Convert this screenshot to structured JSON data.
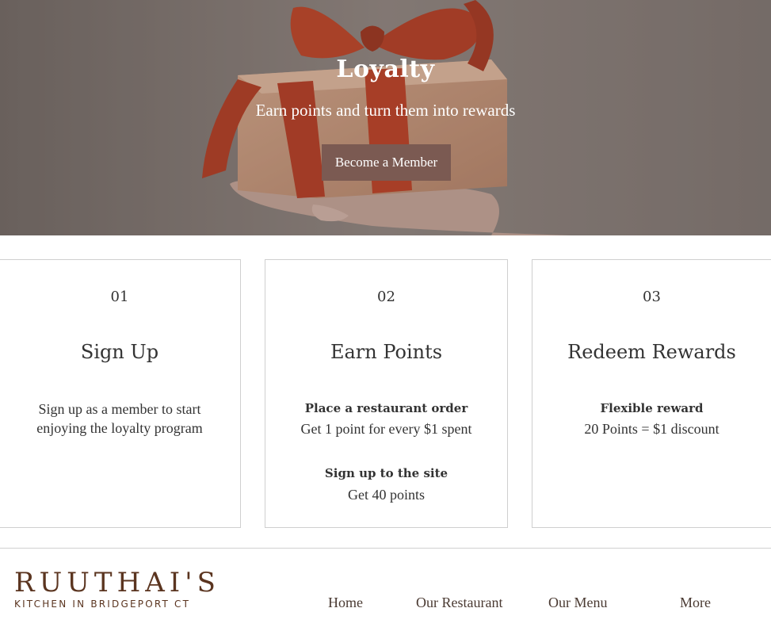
{
  "hero": {
    "title": "Loyalty",
    "subtitle": "Earn points and turn them into rewards",
    "button_label": "Become a Member"
  },
  "steps": [
    {
      "number": "01",
      "title": "Sign Up",
      "text_lines": [
        "Sign up as a member to start",
        "enjoying the loyalty program"
      ]
    },
    {
      "number": "02",
      "title": "Earn Points",
      "items": [
        {
          "heading": "Place a restaurant order",
          "text": "Get 1 point for every $1 spent"
        },
        {
          "heading": "Sign up to the site",
          "text": "Get 40 points"
        }
      ]
    },
    {
      "number": "03",
      "title": "Redeem Rewards",
      "items": [
        {
          "heading": "Flexible reward",
          "text": "20 Points = $1 discount"
        }
      ]
    }
  ],
  "footer": {
    "logo_name": "RUUTHAI'S",
    "logo_tagline": "KITCHEN IN BRIDGEPORT CT",
    "nav": [
      "Home",
      "Our Restaurant",
      "Our Menu",
      "More"
    ]
  },
  "colors": {
    "button_bg": "#7b5a52",
    "logo": "#5b3520",
    "ribbon": "#c0391b"
  }
}
